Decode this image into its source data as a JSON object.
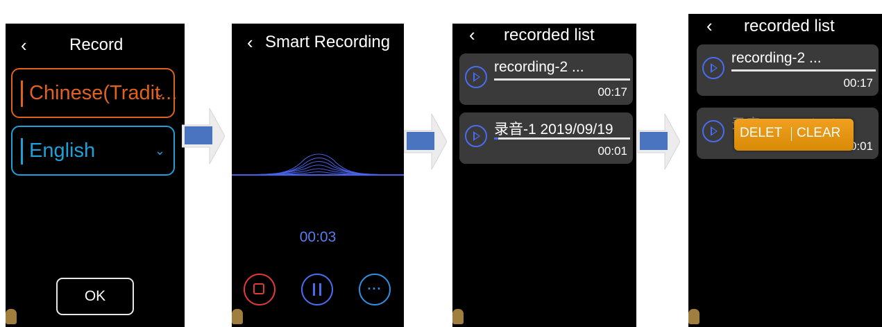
{
  "screens": {
    "record": {
      "title": "Record",
      "source_language": "Chinese(Tradit...",
      "target_language": "English",
      "ok_label": "OK"
    },
    "smart_recording": {
      "title": "Smart Recording",
      "timer": "00:03"
    },
    "recorded_list": {
      "title": "recorded list",
      "items": [
        {
          "name": "recording-2 ...",
          "time": "00:17",
          "progress": 1.0
        },
        {
          "name": "录音-1  2019/09/19",
          "time": "00:01",
          "progress": 0.03
        }
      ]
    },
    "recorded_list_menu": {
      "title": "recorded list",
      "items": [
        {
          "name": "recording-2 ...",
          "time": "00:17"
        },
        {
          "name": "录音-1  2019/09/19",
          "time": "00:01"
        }
      ],
      "menu": {
        "delete_label": "DELET",
        "clear_label": "CLEAR"
      }
    }
  },
  "colors": {
    "accent_orange": "#e0621e",
    "accent_cyan": "#1ea0d8",
    "accent_blue": "#4a6cf0",
    "stop_red": "#e03a3a",
    "menu_orange": "#e6960a"
  },
  "icons": [
    "back-chevron-icon",
    "chevron-down-icon",
    "stop-icon",
    "pause-icon",
    "more-icon",
    "play-icon",
    "step-arrow-icon"
  ]
}
